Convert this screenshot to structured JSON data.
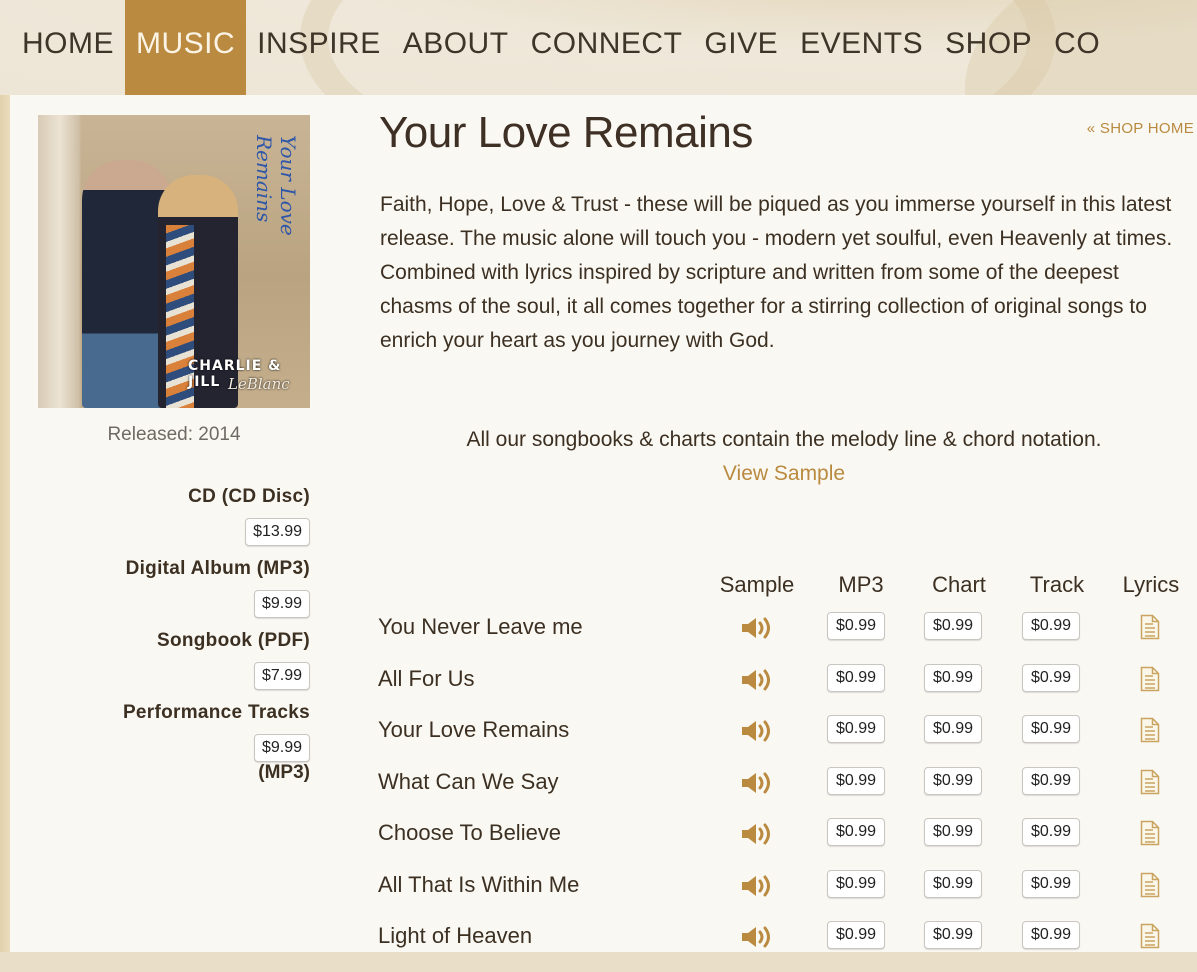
{
  "nav": {
    "items": [
      {
        "label": "HOME",
        "active": false
      },
      {
        "label": "MUSIC",
        "active": true
      },
      {
        "label": "INSPIRE",
        "active": false
      },
      {
        "label": "ABOUT",
        "active": false
      },
      {
        "label": "CONNECT",
        "active": false
      },
      {
        "label": "GIVE",
        "active": false
      },
      {
        "label": "EVENTS",
        "active": false
      },
      {
        "label": "SHOP",
        "active": false
      },
      {
        "label": "CO",
        "active": false
      }
    ]
  },
  "album": {
    "cover_script": "Your Love Remains",
    "cover_artist": "CHARLIE & JILL",
    "cover_artist_surname": "LeBlanc",
    "released": "Released: 2014",
    "formats": [
      {
        "label": "CD (CD Disc)",
        "price": "$13.99",
        "suffix": ""
      },
      {
        "label": "Digital Album (MP3)",
        "price": "$9.99",
        "suffix": ""
      },
      {
        "label": "Songbook (PDF)",
        "price": "$7.99",
        "suffix": ""
      },
      {
        "label": "Performance Tracks",
        "price": "$9.99",
        "suffix": "(MP3)"
      }
    ]
  },
  "main": {
    "title": "Your Love Remains",
    "shop_home": "« SHOP HOME",
    "description": "Faith, Hope, Love & Trust - these will be piqued as you immerse yourself in this latest release. The music alone will touch you - modern yet soulful, even Heavenly at times. Combined with lyrics inspired by scripture and written from some of the deepest chasms of the soul, it all comes together for a stirring collection of original songs to enrich your heart as you journey with God.",
    "note": "All our songbooks & charts contain the melody line & chord notation.",
    "view_sample": "View Sample"
  },
  "tracks": {
    "headers": {
      "sample": "Sample",
      "mp3": "MP3",
      "chart": "Chart",
      "track": "Track",
      "lyrics": "Lyrics"
    },
    "rows": [
      {
        "title": "You Never Leave me",
        "mp3": "$0.99",
        "chart": "$0.99",
        "track": "$0.99"
      },
      {
        "title": "All For Us",
        "mp3": "$0.99",
        "chart": "$0.99",
        "track": "$0.99"
      },
      {
        "title": "Your Love Remains",
        "mp3": "$0.99",
        "chart": "$0.99",
        "track": "$0.99"
      },
      {
        "title": "What Can We Say",
        "mp3": "$0.99",
        "chart": "$0.99",
        "track": "$0.99"
      },
      {
        "title": "Choose To Believe",
        "mp3": "$0.99",
        "chart": "$0.99",
        "track": "$0.99"
      },
      {
        "title": "All That Is Within Me",
        "mp3": "$0.99",
        "chart": "$0.99",
        "track": "$0.99"
      },
      {
        "title": "Light of Heaven",
        "mp3": "$0.99",
        "chart": "$0.99",
        "track": "$0.99"
      }
    ]
  },
  "colors": {
    "accent": "#b98a3f",
    "nav_bg": "#efe8da",
    "page_bg": "#faf8f3",
    "text": "#3c3022"
  }
}
